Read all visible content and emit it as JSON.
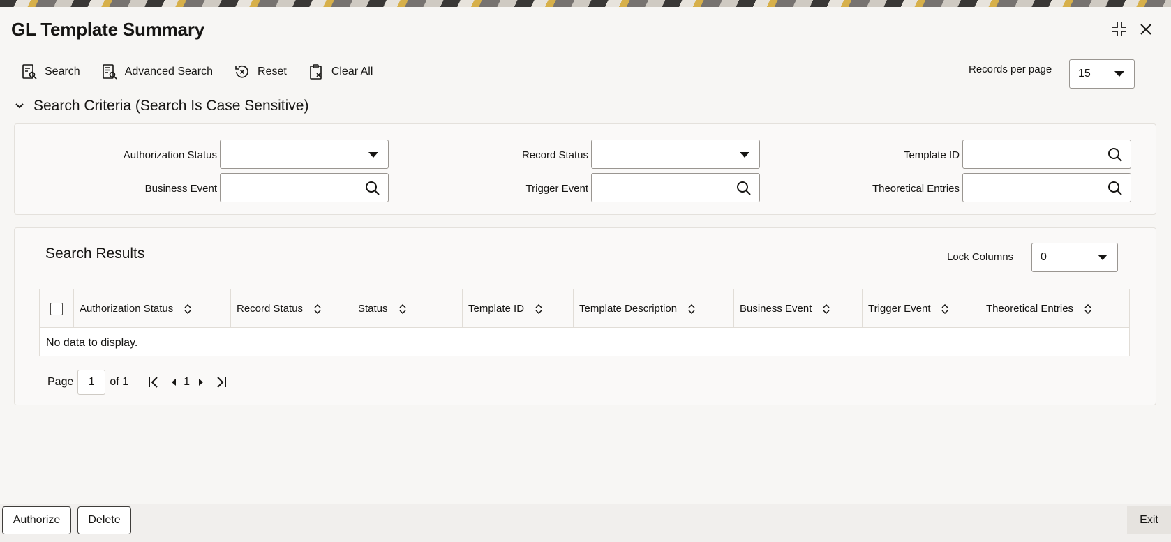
{
  "window": {
    "title": "GL Template Summary"
  },
  "toolbar": {
    "search_label": "Search",
    "advanced_search_label": "Advanced Search",
    "reset_label": "Reset",
    "clear_all_label": "Clear All",
    "records_per_page_label": "Records per page",
    "records_per_page_value": "15"
  },
  "criteria": {
    "header": "Search Criteria (Search Is Case Sensitive)",
    "authorization_status_label": "Authorization Status",
    "authorization_status_value": "",
    "record_status_label": "Record Status",
    "record_status_value": "",
    "template_id_label": "Template ID",
    "template_id_value": "",
    "business_event_label": "Business Event",
    "business_event_value": "",
    "trigger_event_label": "Trigger Event",
    "trigger_event_value": "",
    "theoretical_entries_label": "Theoretical Entries",
    "theoretical_entries_value": ""
  },
  "results": {
    "title": "Search Results",
    "lock_columns_label": "Lock Columns",
    "lock_columns_value": "0",
    "columns": [
      "Authorization Status",
      "Record Status",
      "Status",
      "Template ID",
      "Template Description",
      "Business Event",
      "Trigger Event",
      "Theoretical Entries"
    ],
    "empty_message": "No data to display."
  },
  "pager": {
    "page_label": "Page",
    "current_page": "1",
    "of_label": "of 1",
    "page_number": "1"
  },
  "footer": {
    "authorize_label": "Authorize",
    "delete_label": "Delete",
    "exit_label": "Exit"
  }
}
